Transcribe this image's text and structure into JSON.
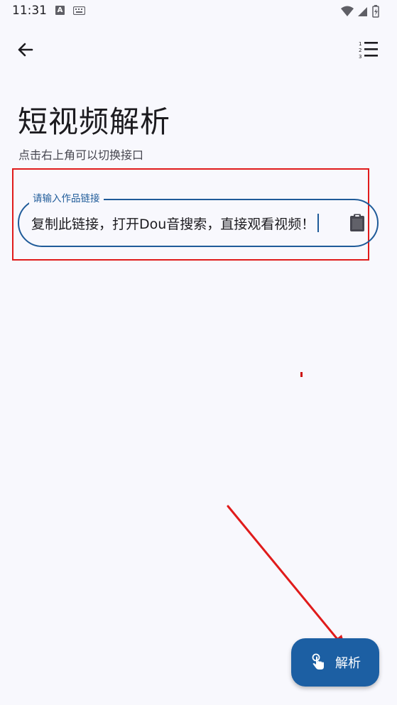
{
  "status_bar": {
    "time": "11:31",
    "a_badge": "A"
  },
  "top_bar": {
    "back_icon": "arrow-left-icon",
    "menu_icon": "numbered-list-icon"
  },
  "header": {
    "title": "短视频解析",
    "subtitle": "点击右上角可以切换接口"
  },
  "url_input": {
    "label": "请输入作品链接",
    "value": "复制此链接，打开Dou音搜索，直接观看视频！",
    "trailing_icon": "clipboard-paste-icon"
  },
  "fab": {
    "label": "解析",
    "icon": "touch-hand-icon"
  },
  "colors": {
    "primary": "#1c5fa3",
    "outline": "#1f5b99",
    "annotation_red": "#e01b1b",
    "background": "#f8f8fd"
  }
}
